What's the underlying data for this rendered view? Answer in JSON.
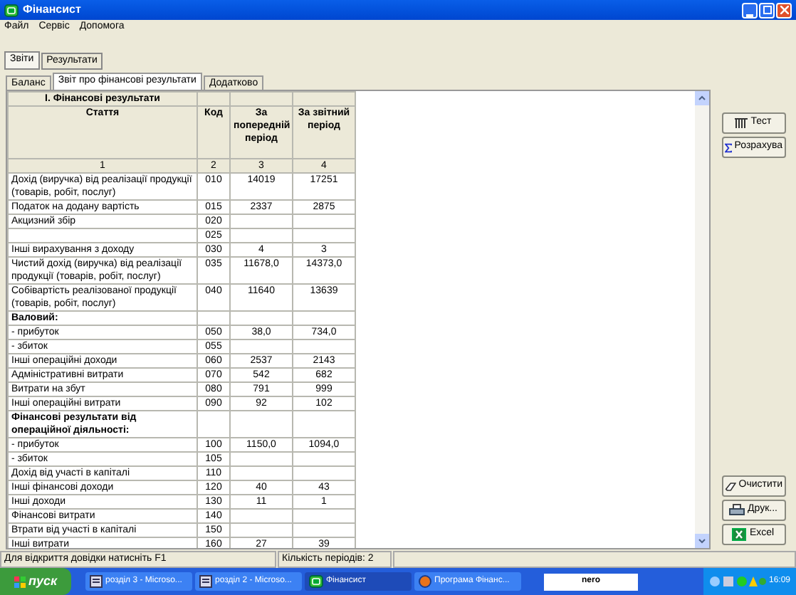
{
  "window": {
    "title": "Фінансист"
  },
  "menu": [
    "Файл",
    "Сервіс",
    "Допомога"
  ],
  "tabs": [
    {
      "label": "Звіти",
      "selected": true
    },
    {
      "label": "Результати",
      "selected": false
    }
  ],
  "subtabs": [
    {
      "label": "Баланс",
      "selected": false
    },
    {
      "label": "Звіт про фінансові результати",
      "selected": true
    },
    {
      "label": "Додатково",
      "selected": false
    }
  ],
  "table": {
    "title": "І. Фінансові результати",
    "columns": [
      "Стаття",
      "Код",
      "За попередній період",
      "За звітний період"
    ],
    "column_numbers": [
      "1",
      "2",
      "3",
      "4"
    ],
    "rows": [
      {
        "kind": "item",
        "article": "Дохід (виручка) від реалізації продукції (товарів, робіт, послуг)",
        "code": "010",
        "previous": "14019",
        "current": "17251"
      },
      {
        "kind": "item",
        "article": "Податок на додану вартість",
        "code": "015",
        "previous": "2337",
        "current": "2875"
      },
      {
        "kind": "item",
        "article": "Акцизний збір",
        "code": "020",
        "previous": "",
        "current": ""
      },
      {
        "kind": "item",
        "article": "",
        "code": "025",
        "previous": "",
        "current": ""
      },
      {
        "kind": "item",
        "article": "Інші вирахування з доходу",
        "code": "030",
        "previous": "4",
        "current": "3"
      },
      {
        "kind": "item",
        "article": "Чистий дохід (виручка) від реалізації продукції (товарів, робіт, послуг)",
        "code": "035",
        "previous": "11678,0",
        "current": "14373,0"
      },
      {
        "kind": "item",
        "article": "Собівартість реалізованої продукції (товарів, робіт, послуг)",
        "code": "040",
        "previous": "11640",
        "current": "13639"
      },
      {
        "kind": "section",
        "article": "Валовий:",
        "code": "",
        "previous": "",
        "current": ""
      },
      {
        "kind": "item",
        "article": "- прибуток",
        "code": "050",
        "previous": "38,0",
        "current": "734,0"
      },
      {
        "kind": "item",
        "article": "- збиток",
        "code": "055",
        "previous": "",
        "current": ""
      },
      {
        "kind": "item",
        "article": "Інші операційні доходи",
        "code": "060",
        "previous": "2537",
        "current": "2143"
      },
      {
        "kind": "item",
        "article": "Адміністративні витрати",
        "code": "070",
        "previous": "542",
        "current": "682"
      },
      {
        "kind": "item",
        "article": "Витрати на збут",
        "code": "080",
        "previous": "791",
        "current": "999"
      },
      {
        "kind": "item",
        "article": "Інші операційні витрати",
        "code": "090",
        "previous": "92",
        "current": "102"
      },
      {
        "kind": "section",
        "article": "Фінансові результати від операційної діяльності:",
        "code": "",
        "previous": "",
        "current": ""
      },
      {
        "kind": "item",
        "article": "- прибуток",
        "code": "100",
        "previous": "1150,0",
        "current": "1094,0"
      },
      {
        "kind": "item",
        "article": "- збиток",
        "code": "105",
        "previous": "",
        "current": ""
      },
      {
        "kind": "item",
        "article": "Дохід від участі в капіталі",
        "code": "110",
        "previous": "",
        "current": ""
      },
      {
        "kind": "item",
        "article": "Інші фінансові доходи",
        "code": "120",
        "previous": "40",
        "current": "43"
      },
      {
        "kind": "item",
        "article": "Інші доходи",
        "code": "130",
        "previous": "11",
        "current": "1"
      },
      {
        "kind": "item",
        "article": "Фінансові витрати",
        "code": "140",
        "previous": "",
        "current": ""
      },
      {
        "kind": "item",
        "article": "Втрати від участі в капіталі",
        "code": "150",
        "previous": "",
        "current": ""
      },
      {
        "kind": "item",
        "article": "Інші витрати",
        "code": "160",
        "previous": "27",
        "current": "39"
      }
    ]
  },
  "side_buttons_top": [
    {
      "kind": "test",
      "label": "Тест"
    },
    {
      "kind": "sum",
      "label": "Розрахува"
    }
  ],
  "side_buttons_bottom": [
    {
      "kind": "clear",
      "label": "Очистити"
    },
    {
      "kind": "print",
      "label": "Друк..."
    },
    {
      "kind": "excel",
      "label": "Excel"
    }
  ],
  "status_bar": {
    "hint": "Для відкриття довідки натисніть F1",
    "periods": "Кількість періодів: 2"
  },
  "taskbar": {
    "start": "пуск",
    "tasks": [
      {
        "kind": "word",
        "label": "розділ 3 - Microso...",
        "selected": false
      },
      {
        "kind": "word",
        "label": "розділ 2 - Microso...",
        "selected": false
      },
      {
        "kind": "app",
        "label": "Фінансист",
        "selected": true
      },
      {
        "kind": "browser",
        "label": "Програма Фінанс...",
        "selected": false
      }
    ],
    "logo": "nero",
    "clock": "16:09"
  }
}
